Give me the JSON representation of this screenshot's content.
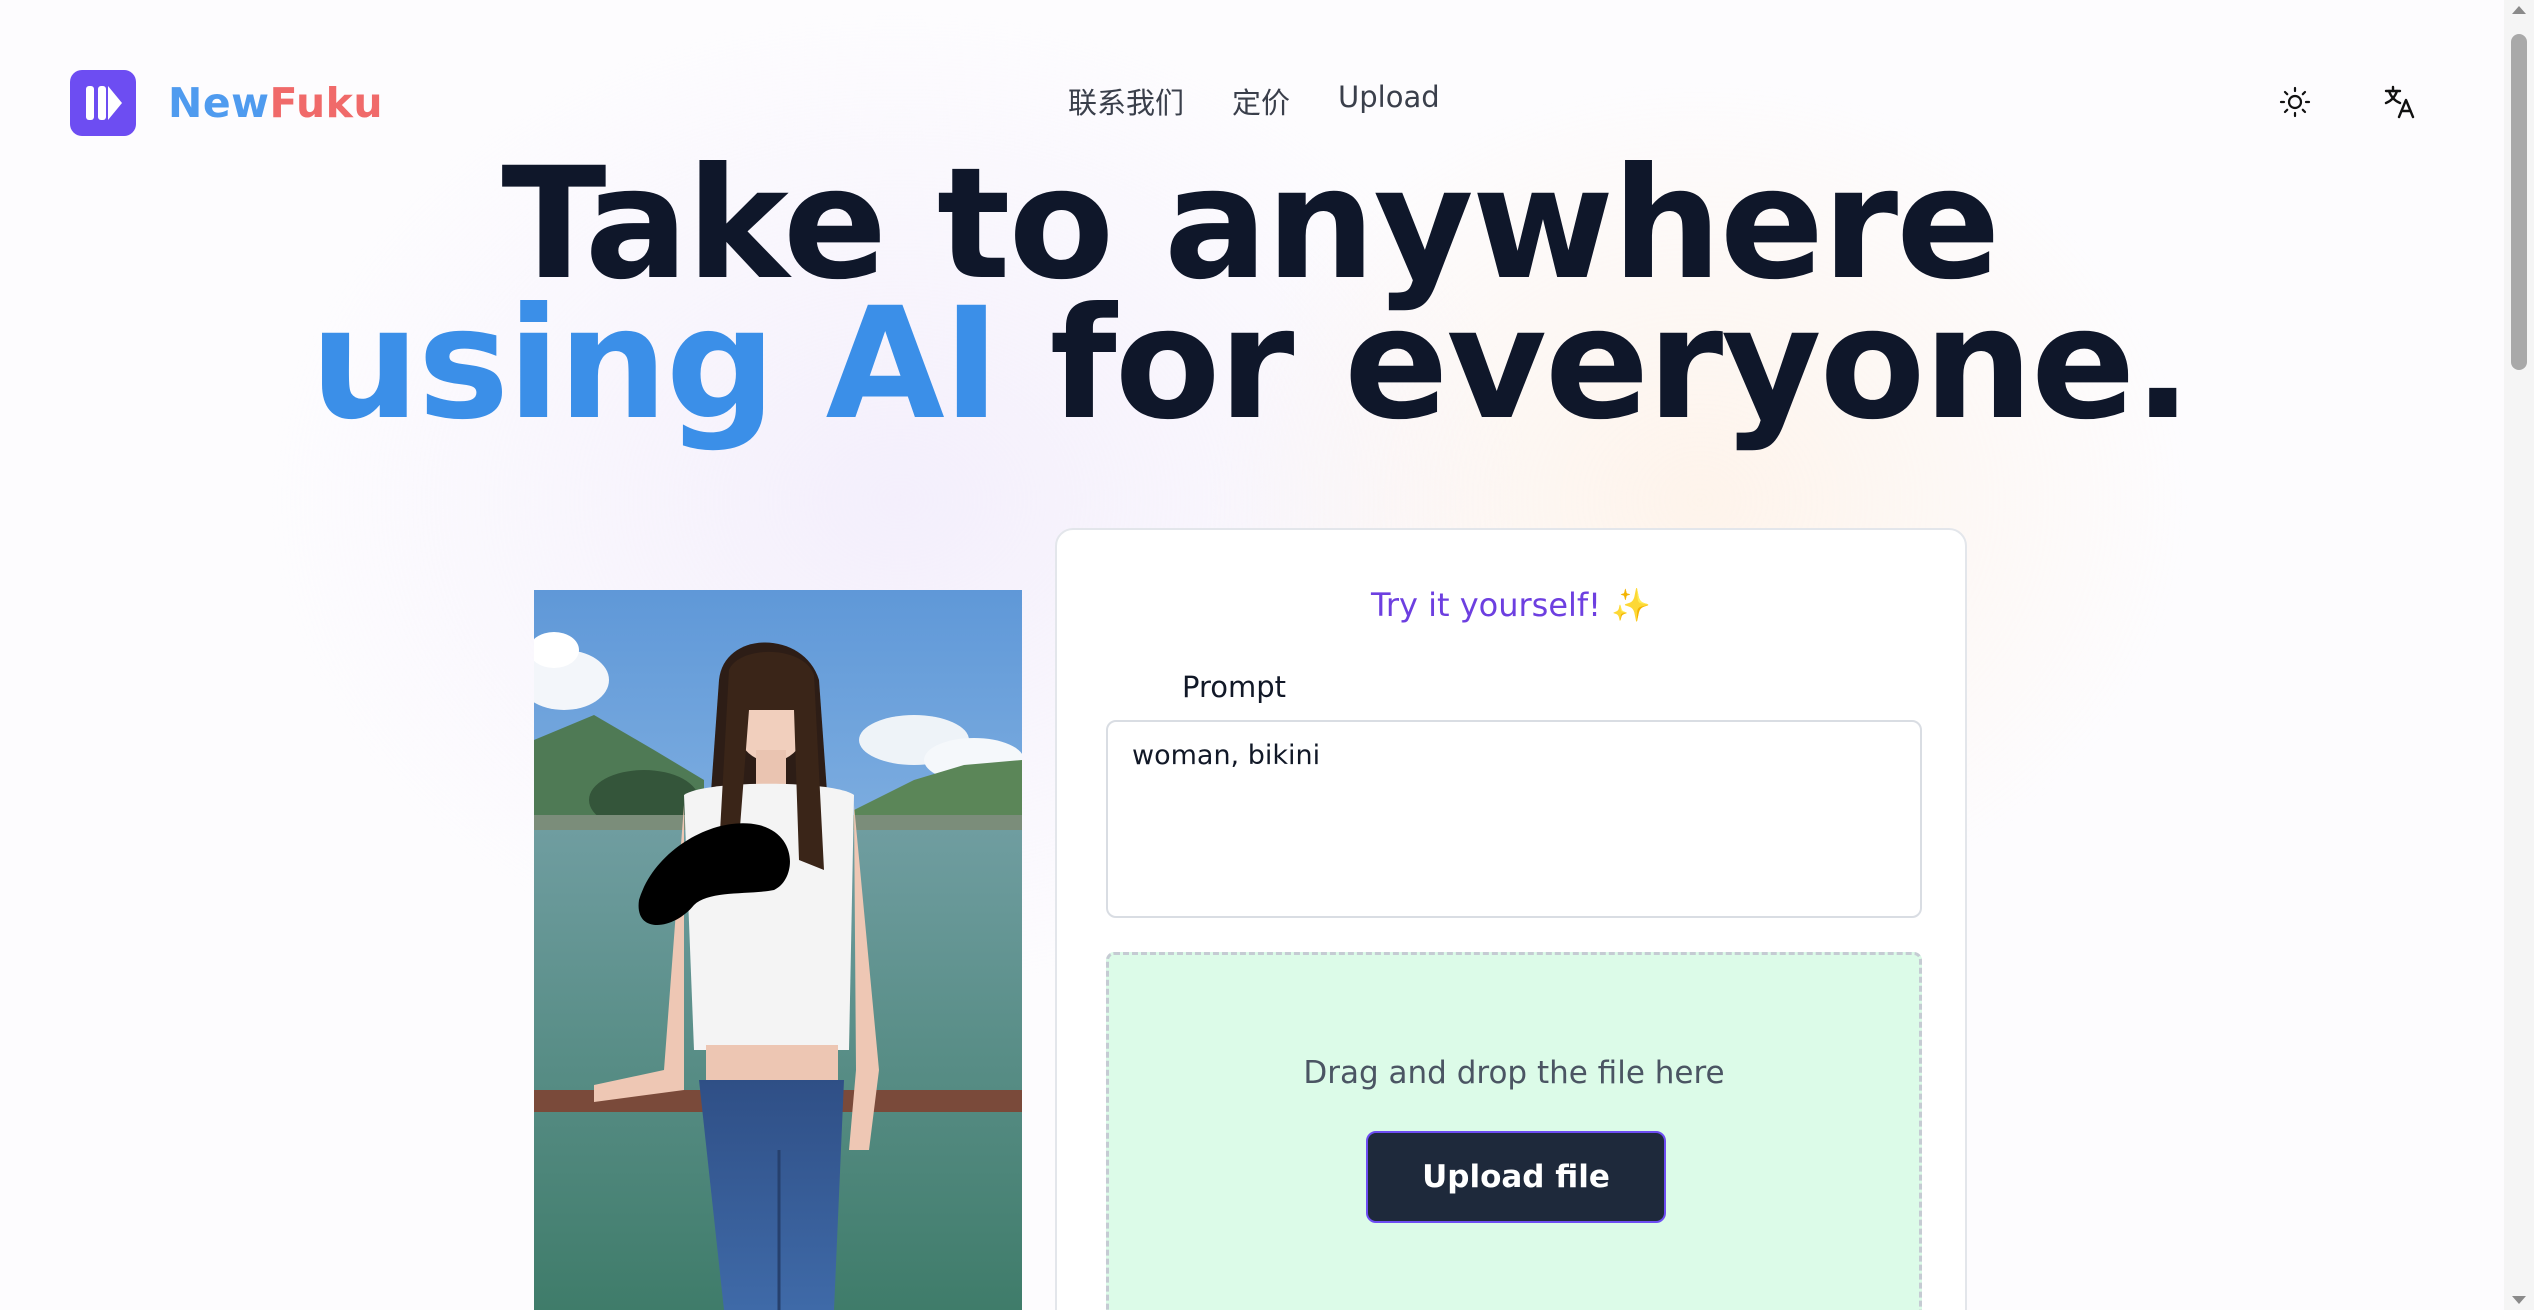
{
  "brand": {
    "name_part1": "New",
    "name_part2": "Fuku"
  },
  "nav": {
    "items": [
      "联系我们",
      "定价",
      "Upload"
    ]
  },
  "header_icons": {
    "theme": "sun-icon",
    "language": "translate-icon"
  },
  "hero": {
    "line1": "Take to anywhere",
    "line2_accent": "using AI",
    "line2_rest": " for everyone."
  },
  "card": {
    "title": "Try it yourself! ✨",
    "prompt_label": "Prompt",
    "prompt_value": "woman, bikini",
    "drop_text": "Drag and drop the file here",
    "upload_button": "Upload file"
  },
  "colors": {
    "brand_purple": "#6d4df2",
    "brand_blue": "#4f9bef",
    "brand_red": "#f06a6a",
    "hero_accent": "#3b8fe8",
    "dropzone_bg": "#dcfbe8",
    "button_dark": "#1e293b"
  }
}
